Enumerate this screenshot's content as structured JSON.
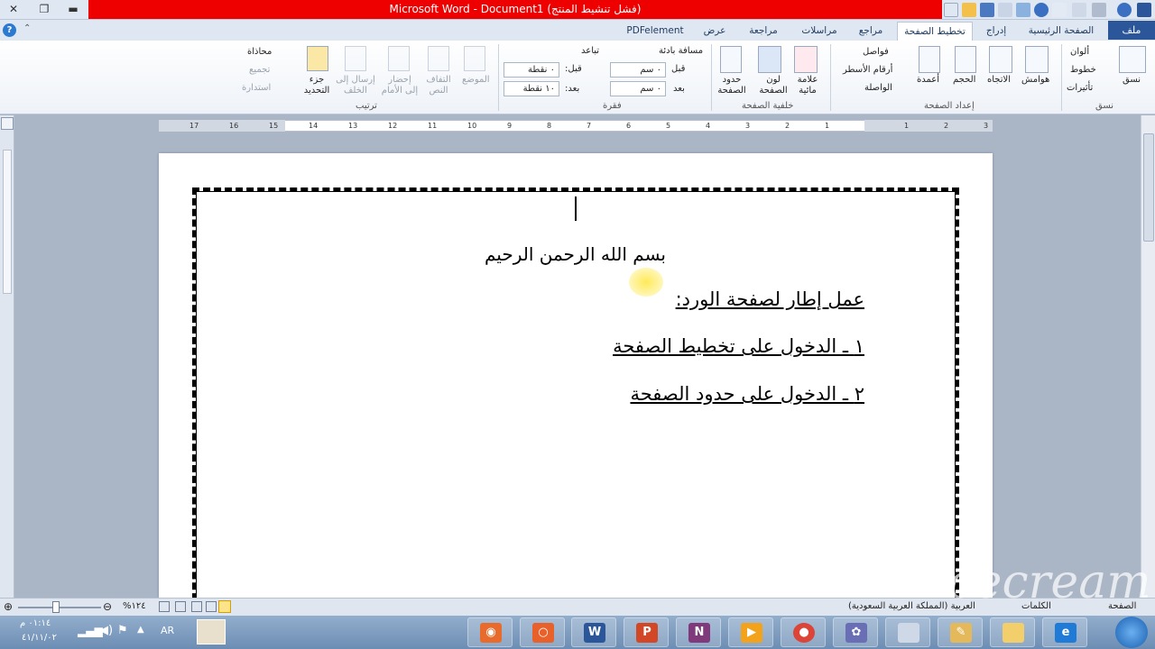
{
  "window": {
    "title": "Microsoft Word - Document1 (فشل تنشيط المنتج)"
  },
  "tabs": {
    "file": "ملف",
    "home": "الصفحة الرئيسية",
    "insert": "إدراج",
    "page_layout": "تخطيط الصفحة",
    "references": "مراجع",
    "mailings": "مراسلات",
    "review": "مراجعة",
    "view": "عرض",
    "pdfelement": "PDFelement"
  },
  "ribbon": {
    "themes": {
      "themes_label": "نسق",
      "colors": "ألوان",
      "fonts": "خطوط",
      "effects": "تأثيرات",
      "group": "نسق"
    },
    "page_setup": {
      "margins": "هوامش",
      "orientation": "الاتجاه",
      "size": "الحجم",
      "columns": "أعمدة",
      "breaks": "فواصل",
      "line_numbers": "أرقام الأسطر",
      "hyphenation": "الواصلة",
      "group": "إعداد الصفحة"
    },
    "page_background": {
      "watermark": "علامة مائية",
      "page_color": "لون الصفحة",
      "page_borders": "حدود الصفحة",
      "group": "خلفية الصفحة"
    },
    "paragraph": {
      "indent": "مسافة بادئة",
      "spacing": "تباعد",
      "before_label": "قبل",
      "after_label": "بعد",
      "indent_before_value": "٠ سم",
      "indent_after_value": "٠ سم",
      "spacing_before_value": "٠ نقطة",
      "spacing_after_value": "١٠ نقطة",
      "spacing_before_label": "قبل:",
      "spacing_after_label": "بعد:",
      "group": "فقرة"
    },
    "arrange": {
      "position": "الموضع",
      "wrap_text": "التفاف النص",
      "bring_forward": "إحضار إلى الأمام",
      "send_backward": "إرسال إلى الخلف",
      "selection_pane": "جزء التحديد",
      "align": "محاذاة",
      "group_cmd": "تجميع",
      "rotate": "استدارة",
      "group": "ترتيب"
    }
  },
  "ruler": {
    "left_numbers": [
      "17",
      "16",
      "15",
      "14",
      "13",
      "12",
      "11",
      "10",
      "9",
      "8",
      "7",
      "6",
      "5",
      "4",
      "3",
      "2",
      "1"
    ],
    "right_numbers": [
      "1",
      "2",
      "3"
    ]
  },
  "document": {
    "line1": "بسم الله الرحمن الرحيم",
    "line2": "عمل إطار لصفحة الورد:",
    "line3": "١ ـ الدخول على تخطيط الصفحة",
    "line4": "٢ ـ الدخول على حدود الصفحة"
  },
  "statusbar": {
    "zoom": "%١٢٤",
    "page": "الصفحة",
    "words": "الكلمات",
    "language": "العربية (المملكة العربية السعودية)"
  },
  "taskbar": {
    "lang": "AR",
    "time": "٠١:١٤ م",
    "date": "٤١/١١/٠٢"
  },
  "watermark_text": "Icecream"
}
